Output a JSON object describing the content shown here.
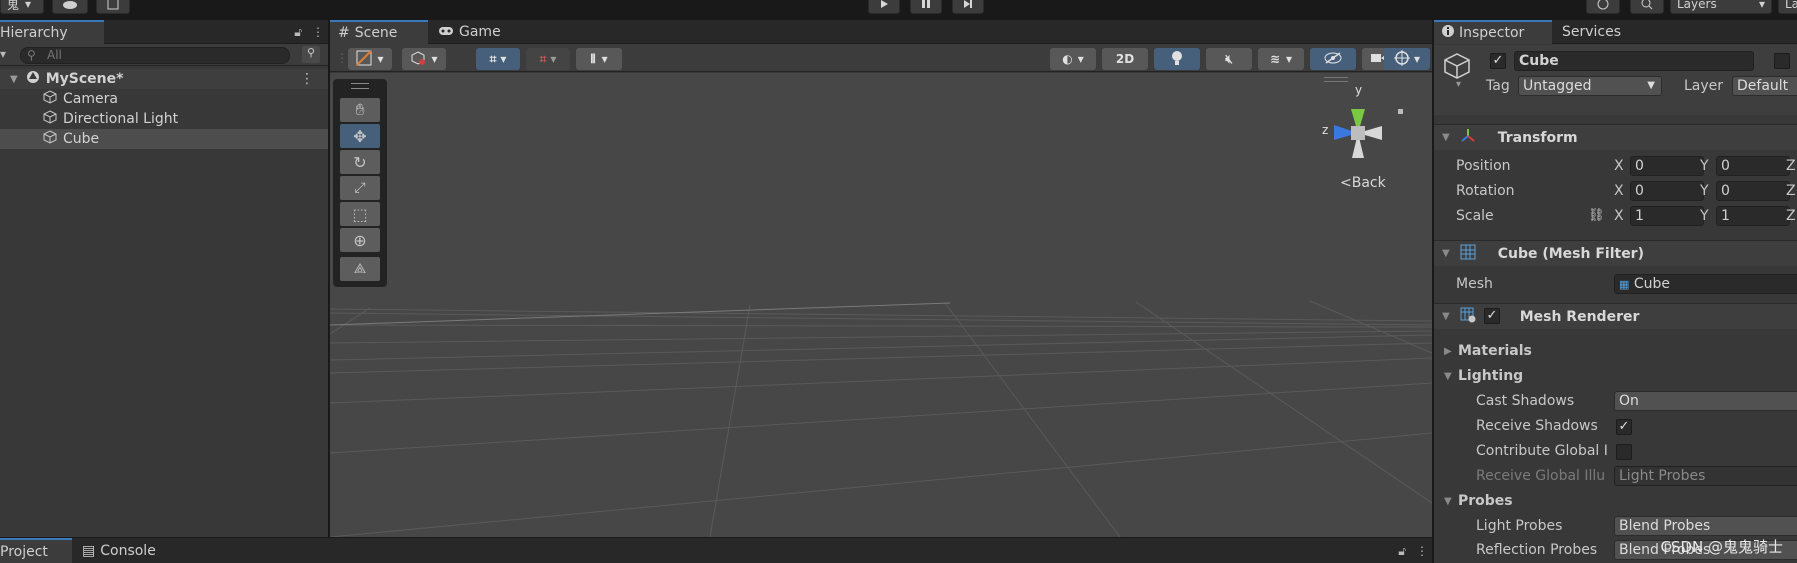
{
  "toolbar": {
    "account_label": "鬼",
    "layers_label": "Layers",
    "layout_label": "La"
  },
  "hierarchy": {
    "tab_label": "Hierarchy",
    "search_placeholder": "All",
    "scene_name": "MyScene*",
    "items": [
      {
        "label": "Camera"
      },
      {
        "label": "Directional Light"
      },
      {
        "label": "Cube"
      }
    ]
  },
  "scene": {
    "tabs": [
      {
        "label": "Scene"
      },
      {
        "label": "Game"
      }
    ],
    "btn_2d": "2D",
    "gizmo": {
      "y": "y",
      "z": "z",
      "back": "Back"
    }
  },
  "inspector": {
    "tabs": [
      {
        "label": "Inspector"
      },
      {
        "label": "Services"
      }
    ],
    "object_name": "Cube",
    "tag_label": "Tag",
    "tag_value": "Untagged",
    "layer_label": "Layer",
    "layer_value": "Default",
    "transform": {
      "title": "Transform",
      "position_label": "Position",
      "rotation_label": "Rotation",
      "scale_label": "Scale",
      "position": {
        "x": "0",
        "y": "0"
      },
      "rotation": {
        "x": "0",
        "y": "0"
      },
      "scale": {
        "x": "1",
        "y": "1"
      },
      "axis_x": "X",
      "axis_y": "Y",
      "axis_z": "Z"
    },
    "mesh_filter": {
      "title": "Cube (Mesh Filter)",
      "mesh_label": "Mesh",
      "mesh_value": "Cube"
    },
    "mesh_renderer": {
      "title": "Mesh Renderer",
      "materials": "Materials",
      "lighting": "Lighting",
      "cast_shadows_label": "Cast Shadows",
      "cast_shadows_value": "On",
      "receive_shadows_label": "Receive Shadows",
      "contribute_gi_label": "Contribute Global I",
      "receive_gi_label": "Receive Global Illu",
      "receive_gi_value": "Light Probes",
      "probes": "Probes",
      "light_probes_label": "Light Probes",
      "light_probes_value": "Blend Probes",
      "reflection_probes_label": "Reflection Probes",
      "reflection_probes_value": "Blend Probes"
    }
  },
  "bottom": {
    "tabs": [
      {
        "label": "Project"
      },
      {
        "label": "Console"
      }
    ]
  },
  "watermark": "CSDN @鬼鬼骑士"
}
